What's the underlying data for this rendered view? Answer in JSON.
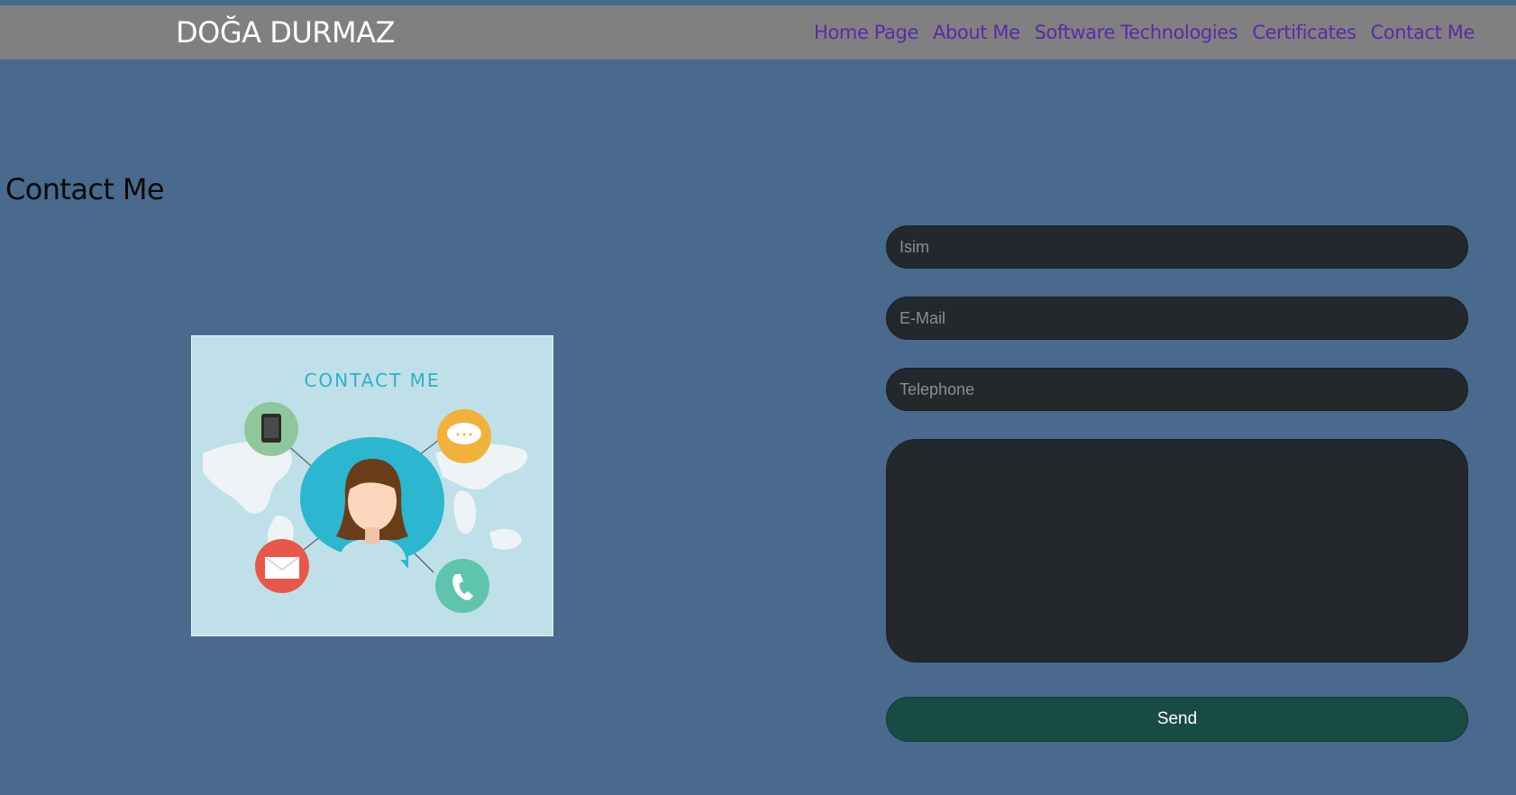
{
  "brand": "DOĞA DURMAZ",
  "nav": {
    "home": "Home Page",
    "about": "About Me",
    "software": "Software Technologies",
    "certificates": "Certificates",
    "contact": "Contact Me"
  },
  "page": {
    "title": "Contact Me"
  },
  "illustration": {
    "caption": "CONTACT ME"
  },
  "form": {
    "name_placeholder": "Isim",
    "email_placeholder": "E-Mail",
    "phone_placeholder": "Telephone",
    "message_placeholder": "",
    "send_label": "Send"
  },
  "colors": {
    "background": "#496a8c",
    "navbar": "#808080",
    "nav_link": "#5b2aa8",
    "field_bg": "#23282d",
    "send_bg": "#174b44"
  }
}
